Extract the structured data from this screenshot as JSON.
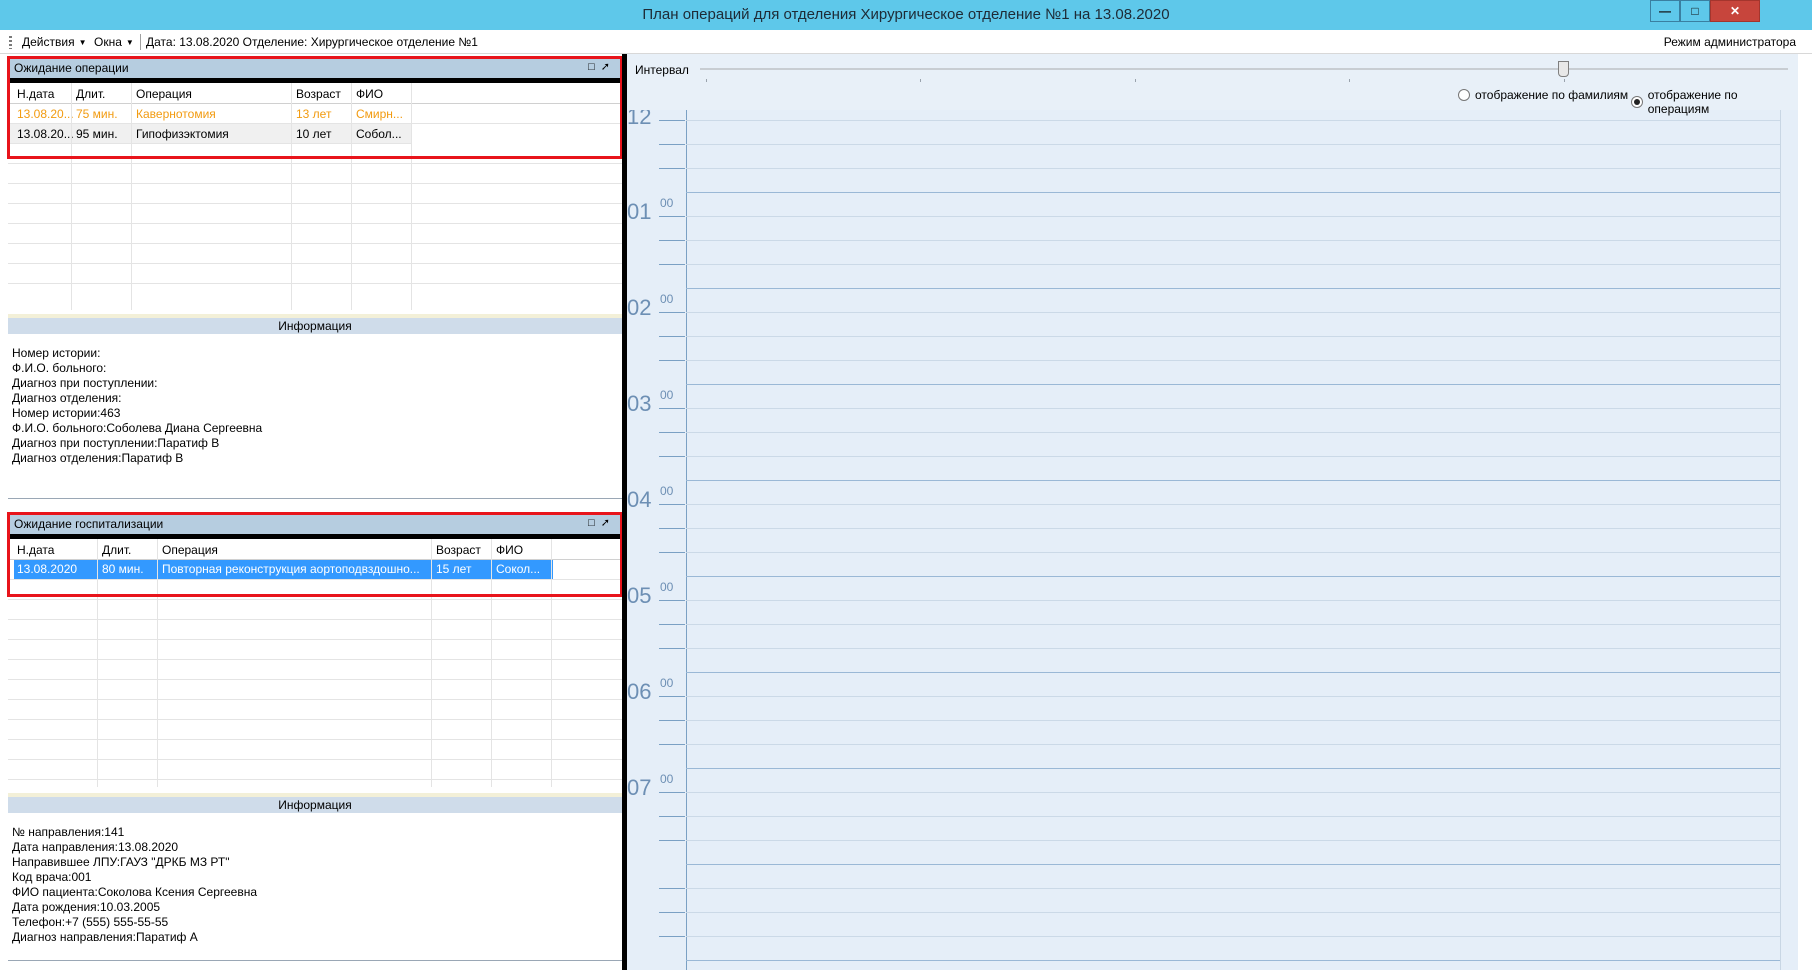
{
  "window": {
    "title": "План операций для отделения Хирургическое отделение №1 на 13.08.2020"
  },
  "menu": {
    "actions_label": "Действия",
    "windows_label": "Окна",
    "info_label": "Дата: 13.08.2020 Отделение: Хирургическое отделение №1",
    "admin_mode_label": "Режим администратора"
  },
  "operations_panel": {
    "title": "Ожидание операции",
    "columns": [
      "Н.дата",
      "Длит.",
      "Операция",
      "Возраст",
      "ФИО"
    ],
    "rows": [
      [
        "13.08.20...",
        "75 мин.",
        "Кавернотомия",
        "13 лет",
        "Смирн..."
      ],
      [
        "13.08.20...",
        "95 мин.",
        "Гипофизэктомия",
        "10 лет",
        "Собол..."
      ]
    ]
  },
  "operations_info": {
    "title": "Информация",
    "lines": [
      "Номер истории:",
      "Ф.И.О. больного:",
      "Диагноз при поступлении:",
      "Диагноз отделения:",
      "Номер истории:463",
      "Ф.И.О. больного:Соболева Диана Сергеевна",
      "Диагноз при поступлении:Паратиф В",
      "Диагноз отделения:Паратиф В"
    ]
  },
  "hospitalization_panel": {
    "title": "Ожидание госпитализации",
    "columns": [
      "Н.дата",
      "Длит.",
      "Операция",
      "Возраст",
      "ФИО"
    ],
    "rows": [
      [
        "13.08.2020",
        "80 мин.",
        "Повторная реконструкция аортоподвздошно...",
        "15 лет",
        "Сокол..."
      ]
    ]
  },
  "hospitalization_info": {
    "title": "Информация",
    "lines": [
      "№ направления:141",
      "Дата направления:13.08.2020",
      "Направившее ЛПУ:ГАУЗ \"ДРКБ МЗ РТ\"",
      "Код врача:001",
      "ФИО пациента:Соколова Ксения Сергеевна",
      "Дата рождения:10.03.2005",
      "Телефон:+7 (555) 555-55-55",
      "Диагноз направления:Паратиф А"
    ]
  },
  "schedule": {
    "interval_label": "Интервал",
    "radio_by_surname": "отображение по фамилиям",
    "radio_by_operation": "отображение по операциям",
    "selected_radio": "отображение по операциям",
    "hours": [
      "12",
      "01",
      "02",
      "03",
      "04",
      "05",
      "06",
      "07"
    ],
    "minute_label": "00"
  },
  "colors": {
    "titlebar": "#5ec8ea",
    "highlight_box": "#e8141b",
    "selected_row": "#3399ff",
    "pending_row_text": "#f29b10",
    "schedule_bg": "#e5eef8"
  }
}
